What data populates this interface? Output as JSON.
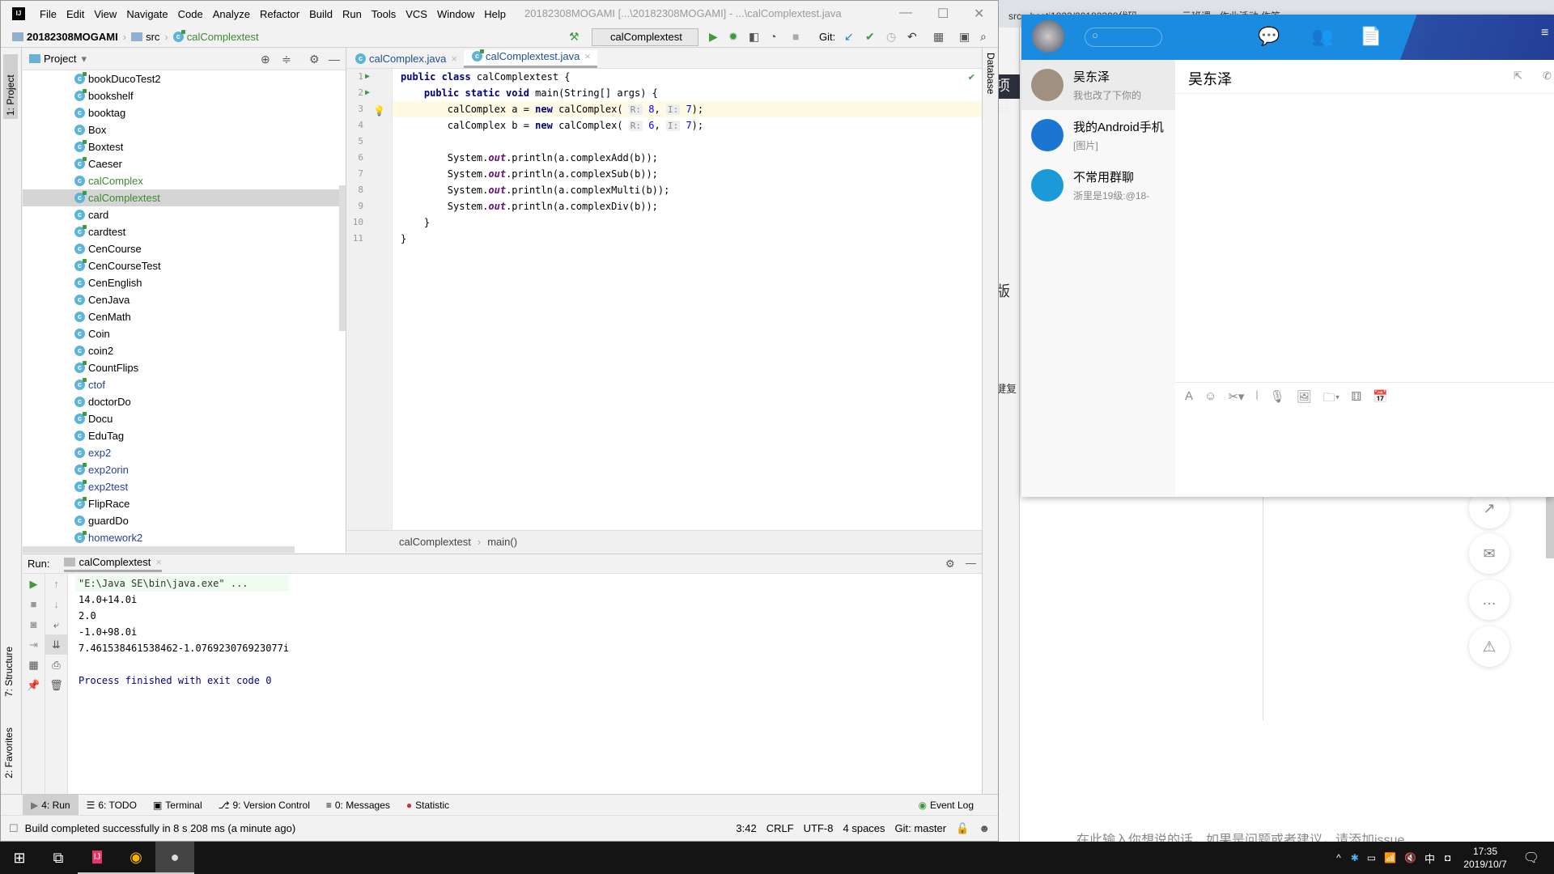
{
  "browser": {
    "tabs": [
      {
        "label": "src · hasti1823/20182308代码"
      },
      {
        "label": "云班课 - 作业活动 作答"
      }
    ],
    "side_texts": [
      "项目",
      "版",
      "鍵复"
    ],
    "bottom_text": "在此输入你想说的话，如果是问题或者建议，请添加issue"
  },
  "ide": {
    "menu": [
      "File",
      "Edit",
      "View",
      "Navigate",
      "Code",
      "Analyze",
      "Refactor",
      "Build",
      "Run",
      "Tools",
      "VCS",
      "Window",
      "Help"
    ],
    "window_title": "20182308MOGAMI [...\\20182308MOGAMI] - ...\\calComplextest.java",
    "breadcrumb": {
      "project": "20182308MOGAMI",
      "folder": "src",
      "file": "calComplextest"
    },
    "run_config": "calComplextest",
    "git_label": "Git:",
    "project_panel": {
      "title": "Project",
      "items": [
        {
          "name": "bookDucoTest2",
          "run": true,
          "style": ""
        },
        {
          "name": "bookshelf",
          "run": true,
          "style": ""
        },
        {
          "name": "booktag",
          "run": false,
          "style": ""
        },
        {
          "name": "Box",
          "run": false,
          "style": ""
        },
        {
          "name": "Boxtest",
          "run": true,
          "style": ""
        },
        {
          "name": "Caeser",
          "run": true,
          "style": ""
        },
        {
          "name": "calComplex",
          "run": false,
          "style": "green"
        },
        {
          "name": "calComplextest",
          "run": true,
          "style": "green",
          "selected": true
        },
        {
          "name": "card",
          "run": false,
          "style": ""
        },
        {
          "name": "cardtest",
          "run": true,
          "style": ""
        },
        {
          "name": "CenCourse",
          "run": false,
          "style": ""
        },
        {
          "name": "CenCourseTest",
          "run": true,
          "style": ""
        },
        {
          "name": "CenEnglish",
          "run": false,
          "style": ""
        },
        {
          "name": "CenJava",
          "run": false,
          "style": ""
        },
        {
          "name": "CenMath",
          "run": false,
          "style": ""
        },
        {
          "name": "Coin",
          "run": false,
          "style": ""
        },
        {
          "name": "coin2",
          "run": false,
          "style": ""
        },
        {
          "name": "CountFlips",
          "run": true,
          "style": ""
        },
        {
          "name": "ctof",
          "run": true,
          "style": "blue"
        },
        {
          "name": "doctorDo",
          "run": false,
          "style": ""
        },
        {
          "name": "Docu",
          "run": true,
          "style": ""
        },
        {
          "name": "EduTag",
          "run": false,
          "style": ""
        },
        {
          "name": "exp2",
          "run": false,
          "style": "blue"
        },
        {
          "name": "exp2orin",
          "run": true,
          "style": "blue"
        },
        {
          "name": "exp2test",
          "run": true,
          "style": "blue"
        },
        {
          "name": "FlipRace",
          "run": true,
          "style": ""
        },
        {
          "name": "guardDo",
          "run": false,
          "style": ""
        },
        {
          "name": "homework2",
          "run": true,
          "style": "blue"
        }
      ]
    },
    "editor": {
      "tabs": [
        {
          "label": "calComplex.java",
          "active": false
        },
        {
          "label": "calComplextest.java",
          "active": true
        }
      ],
      "lines": [
        {
          "n": "1",
          "html": "<span class='kw'>public class</span> calComplextest {",
          "run": true
        },
        {
          "n": "2",
          "html": "    <span class='kw'>public static void</span> main(String[] args) {",
          "run": true
        },
        {
          "n": "3",
          "html": "        calComplex a = <span class='kw'>new</span> calComplex( <span class='hint'>R:</span> <span class='num'>8</span>, <span class='hint'>I:</span> <span class='num'>7</span>);",
          "current": true
        },
        {
          "n": "4",
          "html": "        calComplex b = <span class='kw'>new</span> calComplex( <span class='hint'>R:</span> <span class='num'>6</span>, <span class='hint'>I:</span> <span class='num'>7</span>);"
        },
        {
          "n": "5",
          "html": ""
        },
        {
          "n": "6",
          "html": "        System.<span class='it'>out</span>.println(a.complexAdd(b));"
        },
        {
          "n": "7",
          "html": "        System.<span class='it'>out</span>.println(a.complexSub(b));"
        },
        {
          "n": "8",
          "html": "        System.<span class='it'>out</span>.println(a.complexMulti(b));"
        },
        {
          "n": "9",
          "html": "        System.<span class='it'>out</span>.println(a.complexDiv(b));"
        },
        {
          "n": "10",
          "html": "    }"
        },
        {
          "n": "11",
          "html": "}"
        }
      ],
      "crumb": [
        "calComplextest",
        "main()"
      ]
    },
    "right_stripe": "Database",
    "left_stripe": [
      "1: Project",
      "7: Structure",
      "2: Favorites"
    ],
    "run_panel": {
      "label": "Run:",
      "tab": "calComplextest",
      "output": [
        "\"E:\\Java SE\\bin\\java.exe\" ...",
        "14.0+14.0i",
        "2.0",
        "-1.0+98.0i",
        "7.461538461538462-1.076923076923077i",
        "",
        "Process finished with exit code 0"
      ]
    },
    "tool_windows": [
      "4: Run",
      "6: TODO",
      "Terminal",
      "9: Version Control",
      "0: Messages",
      "Statistic"
    ],
    "event_log": "Event Log",
    "status": {
      "message": "Build completed successfully in 8 s 208 ms (a minute ago)",
      "position": "3:42",
      "line_sep": "CRLF",
      "encoding": "UTF-8",
      "indent": "4 spaces",
      "git": "Git: master"
    }
  },
  "qq": {
    "search_placeholder": "",
    "conversations": [
      {
        "name": "吴东泽",
        "msg": "我也改了下你的",
        "selected": true,
        "color": "#a09080"
      },
      {
        "name": "我的Android手机",
        "msg": "[图片]",
        "color": "#1a76d2"
      },
      {
        "name": "不常用群聊",
        "msg": "浙里是19级:@18-",
        "color": "#1a9ad8"
      }
    ],
    "chat_title": "吴东泽"
  },
  "taskbar": {
    "time": "17:35",
    "date": "2019/10/7",
    "ime": "中"
  }
}
